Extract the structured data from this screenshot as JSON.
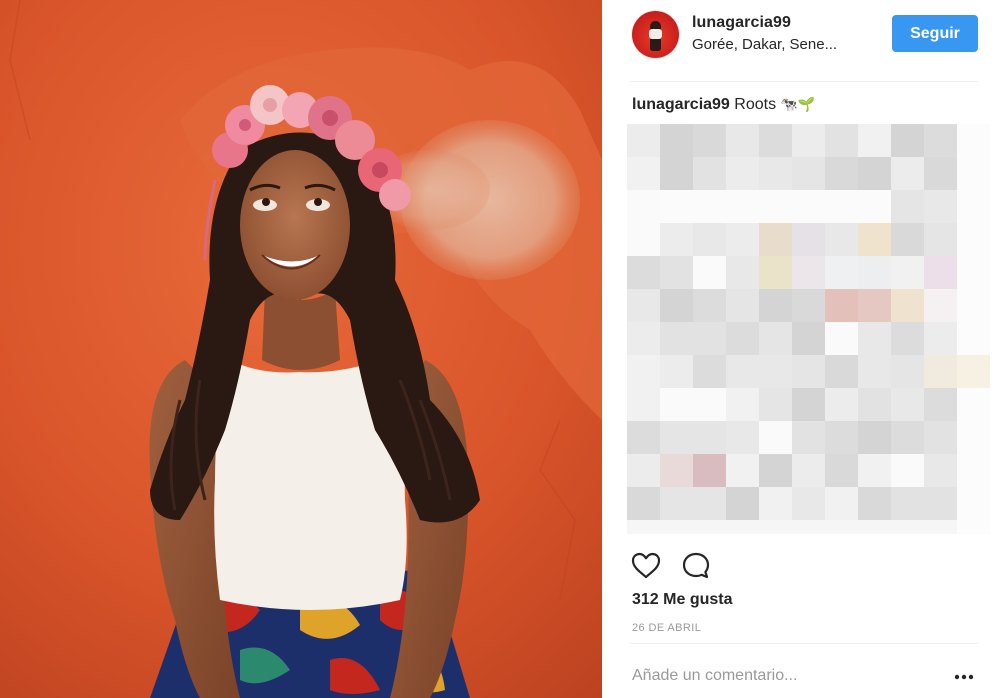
{
  "post": {
    "photo_alt": "",
    "header": {
      "username": "lunagarcia99",
      "location": "Gorée, Dakar, Sene..."
    },
    "follow_label": "Seguir",
    "caption": {
      "username": "lunagarcia99",
      "text": "Roots",
      "emoji": "🐄🌱"
    },
    "likes_label": "312 Me gusta",
    "date_label": "26 DE ABRIL",
    "comment_placeholder": "Añade un comentario...",
    "icons": {
      "like": "heart-icon",
      "comment": "comment-bubble-icon",
      "more": "more-options-icon"
    },
    "colors": {
      "follow_button": "#3897f0",
      "wall": "#d9542a",
      "text": "#262626",
      "muted": "#999999"
    }
  }
}
